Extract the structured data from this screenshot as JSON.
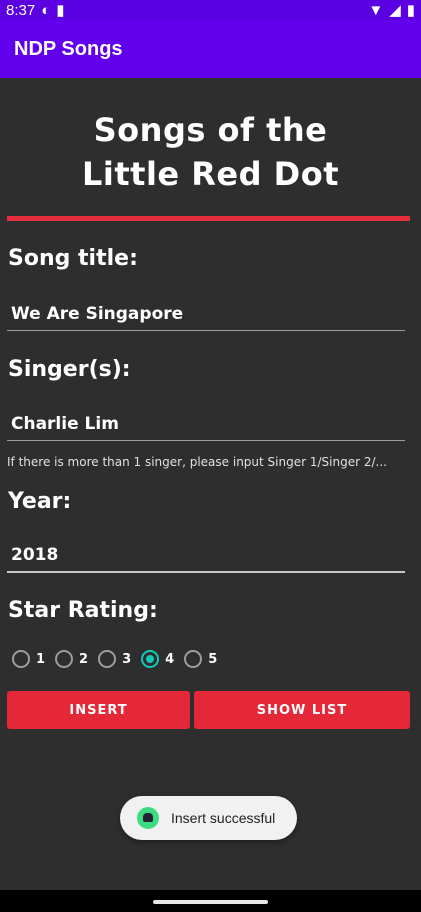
{
  "status_bar": {
    "time": "8:37"
  },
  "app_bar": {
    "title": "NDP Songs"
  },
  "header": {
    "line1": "Songs of the",
    "line2": "Little Red Dot"
  },
  "form": {
    "song_title_label": "Song title:",
    "song_title_value": "We Are Singapore",
    "singer_label": "Singer(s):",
    "singer_value": "Charlie Lim",
    "singer_hint": "If there is more than 1 singer, please input Singer 1/Singer 2/...",
    "year_label": "Year:",
    "year_value": "2018",
    "rating_label": "Star Rating:",
    "rating_options": [
      "1",
      "2",
      "3",
      "4",
      "5"
    ],
    "rating_selected": "4"
  },
  "buttons": {
    "insert": "INSERT",
    "show_list": "SHOW LIST"
  },
  "toast": {
    "message": "Insert successful"
  },
  "colors": {
    "app_bar": "#6200ee",
    "accent_red": "#e52838",
    "radio_checked": "#12c9b8"
  }
}
